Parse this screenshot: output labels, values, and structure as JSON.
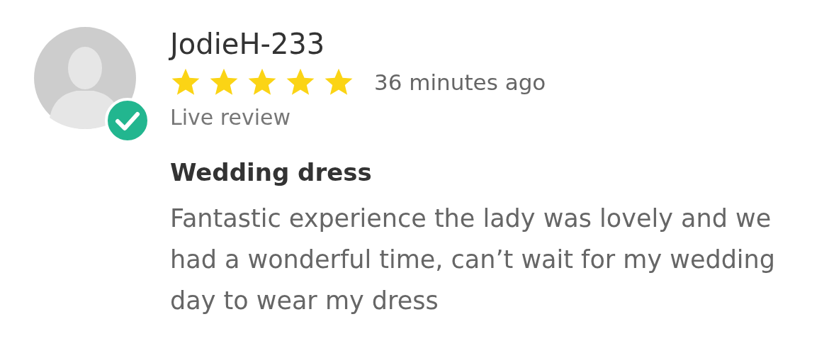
{
  "review": {
    "author": "JodieH-233",
    "verified": true,
    "stars": 5,
    "time": "36 minutes ago",
    "status": "Live review",
    "title": "Wedding dress",
    "body": "Fantastic experience the lady was lovely and we had a wonderful time, can’t wait for my wedding day to wear my dress"
  }
}
